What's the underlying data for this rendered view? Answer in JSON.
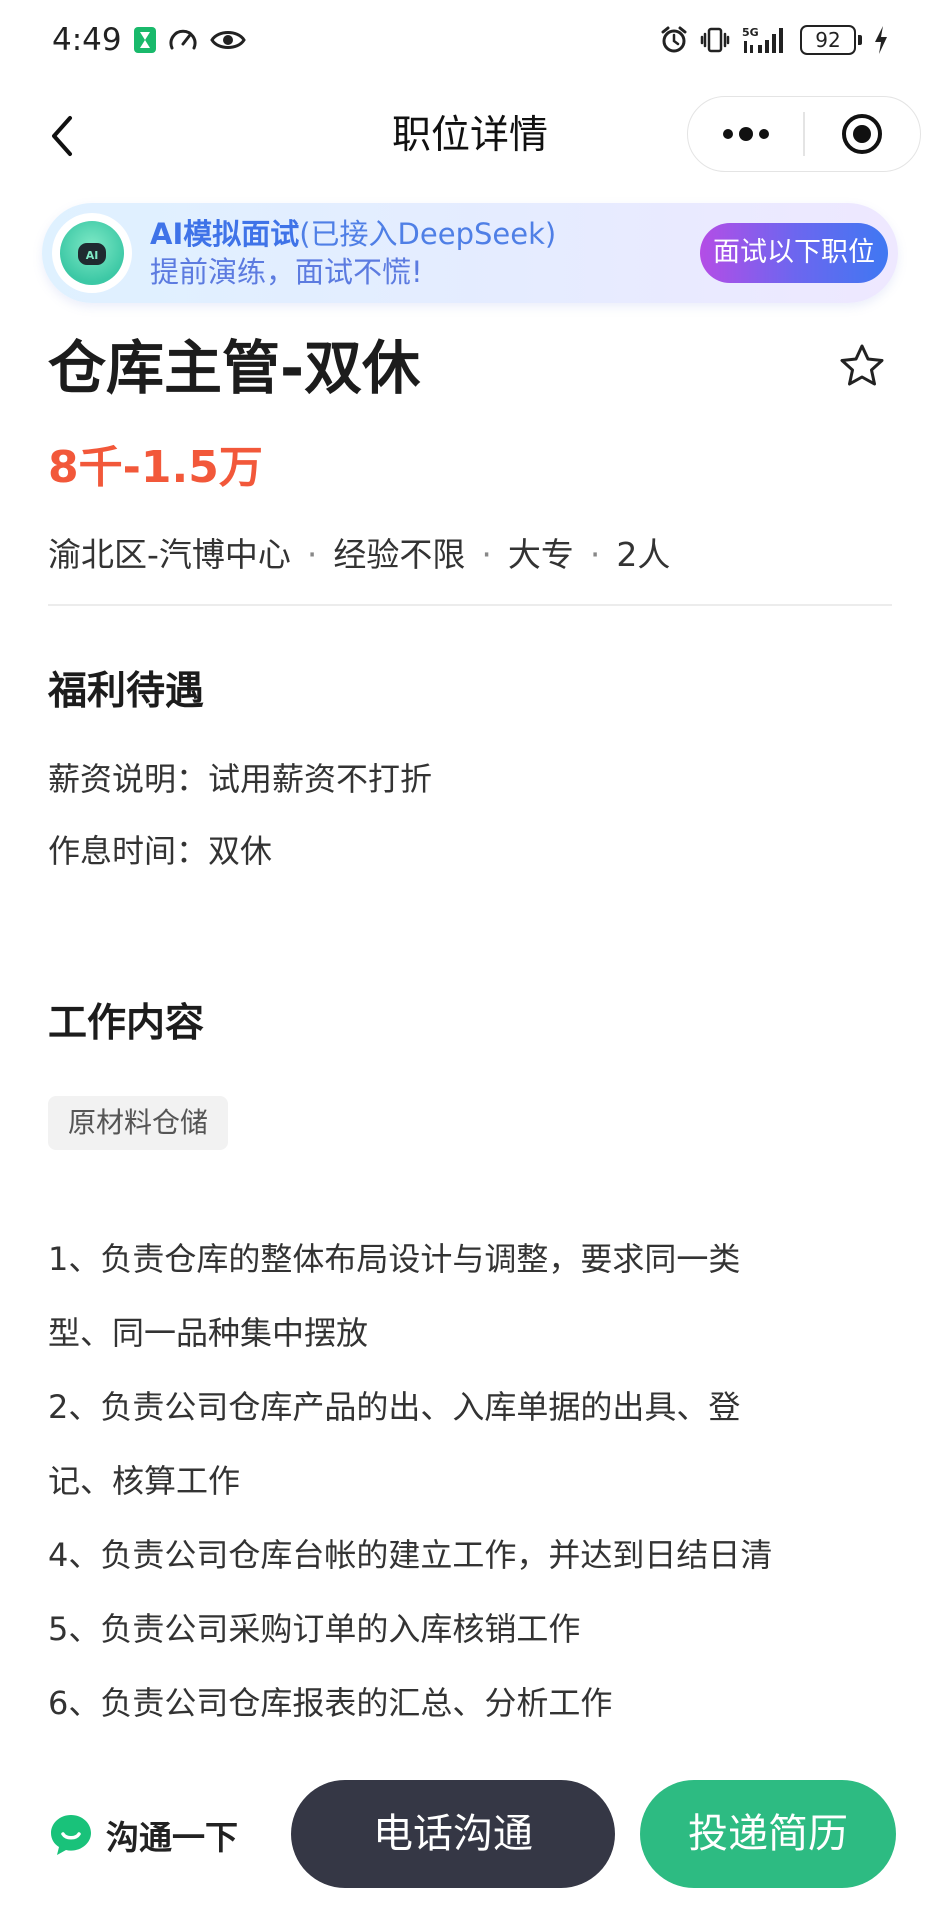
{
  "status_bar": {
    "time": "4:49",
    "battery": "92",
    "network": "5G",
    "icons": [
      "hourglass-icon",
      "speedometer-icon",
      "eye-icon",
      "alarm-icon",
      "vibrate-icon",
      "signal-icon",
      "battery-icon",
      "charging-icon"
    ],
    "accent_color": "#19b96b"
  },
  "nav": {
    "title": "职位详情",
    "back_icon": "chevron-left-icon",
    "more_icon": "more-dots-icon",
    "close_icon": "target-circle-icon"
  },
  "ai_banner": {
    "title_bold": "AI模拟面试",
    "title_rest": "(已接入DeepSeek)",
    "subtitle": "提前演练，面试不慌!",
    "cta": "面试以下职位",
    "avatar_label": "AI"
  },
  "job": {
    "title": "仓库主管-双休",
    "salary": "8千-1.5万",
    "meta": [
      "渝北区-汽博中心",
      "经验不限",
      "大专",
      "2人"
    ],
    "favorite_icon": "star-outline-icon",
    "salary_color": "#f2583a"
  },
  "benefits": {
    "title": "福利待遇",
    "rows": [
      {
        "label": "薪资说明：",
        "value": "试用薪资不打折"
      },
      {
        "label": "作息时间：",
        "value": "双休"
      }
    ]
  },
  "job_content": {
    "title": "工作内容",
    "tag": "原材料仓储",
    "lines": [
      "1、负责仓库的整体布局设计与调整，要求同一类",
      "型、同一品种集中摆放",
      "2、负责公司仓库产品的出、入库单据的出具、登",
      "记、核算工作",
      "4、负责公司仓库台帐的建立工作，并达到日结日清",
      "5、负责公司采购订单的入库核销工作",
      "6、负责公司仓库报表的汇总、分析工作"
    ]
  },
  "bottom": {
    "chat_label": "沟通一下",
    "phone_button": "电话沟通",
    "apply_button": "投递简历",
    "phone_color": "#353745",
    "apply_color": "#2dbb82"
  }
}
